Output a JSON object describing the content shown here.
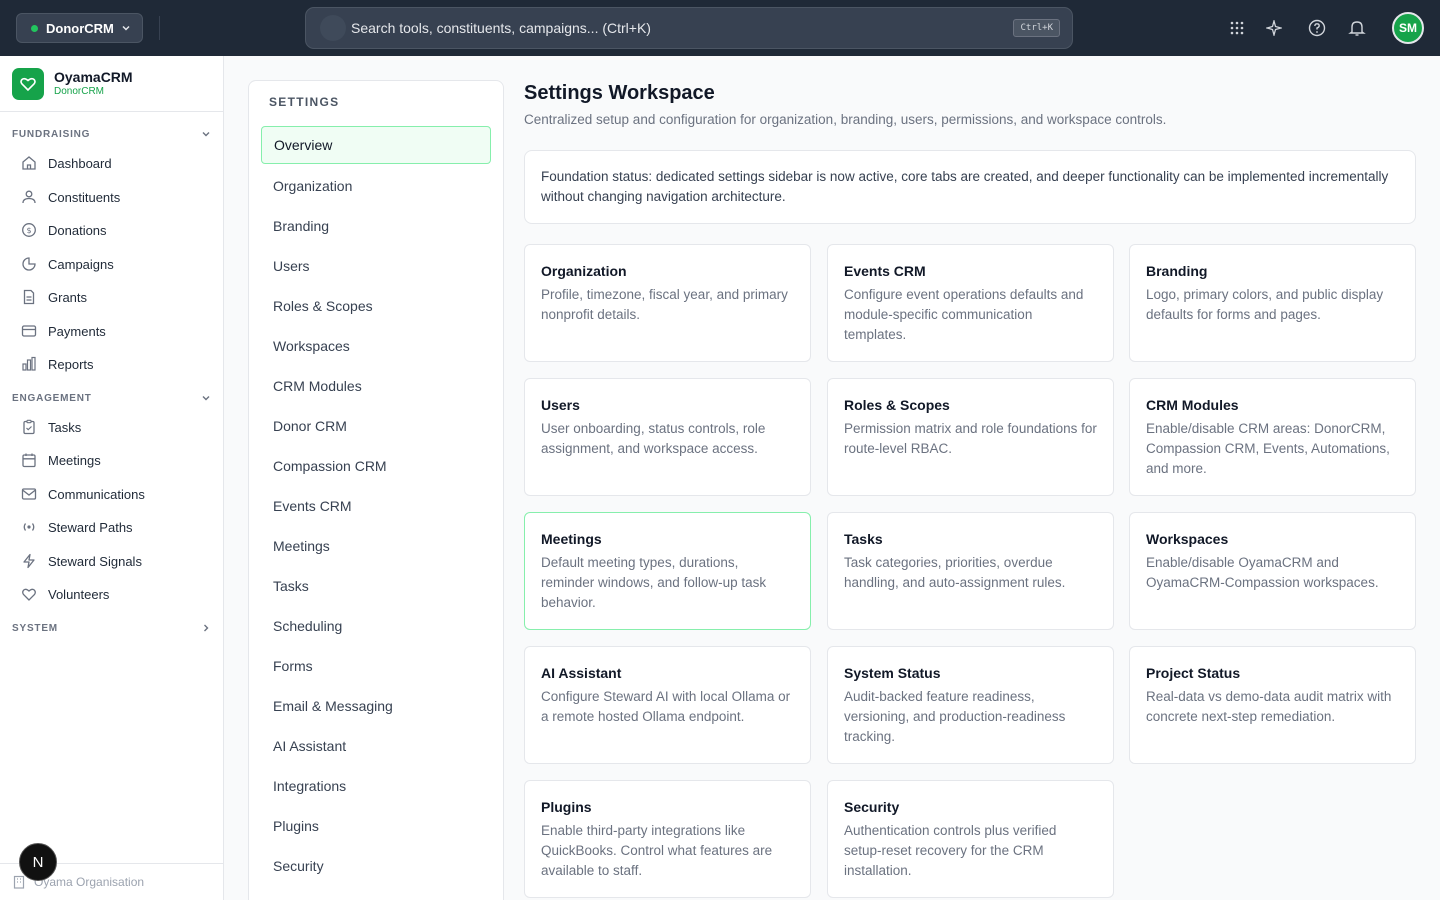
{
  "topbar": {
    "workspace_label": "DonorCRM",
    "search_placeholder": "Search tools, constituents, campaigns... (Ctrl+K)",
    "search_shortcut": "Ctrl+K",
    "avatar_initials": "SM"
  },
  "sidebar": {
    "brand_name": "OyamaCRM",
    "brand_sub": "DonorCRM",
    "sections": [
      {
        "label": "FUNDRAISING"
      },
      {
        "label": "ENGAGEMENT"
      },
      {
        "label": "SYSTEM"
      }
    ],
    "items": [
      {
        "label": "Dashboard",
        "icon": "home-icon"
      },
      {
        "label": "Constituents",
        "icon": "users-icon"
      },
      {
        "label": "Donations",
        "icon": "dollar-icon"
      },
      {
        "label": "Campaigns",
        "icon": "pie-icon"
      },
      {
        "label": "Grants",
        "icon": "document-icon"
      },
      {
        "label": "Payments",
        "icon": "credit-card-icon"
      },
      {
        "label": "Reports",
        "icon": "bar-chart-icon"
      },
      {
        "label": "Tasks",
        "icon": "clipboard-icon"
      },
      {
        "label": "Meetings",
        "icon": "calendar-icon"
      },
      {
        "label": "Communications",
        "icon": "mail-icon"
      },
      {
        "label": "Steward Paths",
        "icon": "radio-icon"
      },
      {
        "label": "Steward Signals",
        "icon": "bolt-icon"
      },
      {
        "label": "Volunteers",
        "icon": "heart-icon"
      }
    ],
    "org_label": "Oyama Organisation",
    "next_badge": "N"
  },
  "settings_nav": {
    "title": "SETTINGS",
    "items": [
      "Overview",
      "Organization",
      "Branding",
      "Users",
      "Roles & Scopes",
      "Workspaces",
      "CRM Modules",
      "Donor CRM",
      "Compassion CRM",
      "Events CRM",
      "Meetings",
      "Tasks",
      "Scheduling",
      "Forms",
      "Email & Messaging",
      "AI Assistant",
      "Integrations",
      "Plugins",
      "Security"
    ],
    "active": "Overview"
  },
  "main": {
    "title": "Settings Workspace",
    "subtitle": "Centralized setup and configuration for organization, branding, users, permissions, and workspace controls.",
    "notice": "Foundation status: dedicated settings sidebar is now active, core tabs are created, and deeper functionality can be implemented incrementally without changing navigation architecture.",
    "cards": [
      {
        "title": "Organization",
        "desc": "Profile, timezone, fiscal year, and primary nonprofit details."
      },
      {
        "title": "Events CRM",
        "desc": "Configure event operations defaults and module-specific communication templates."
      },
      {
        "title": "Branding",
        "desc": "Logo, primary colors, and public display defaults for forms and pages."
      },
      {
        "title": "Users",
        "desc": "User onboarding, status controls, role assignment, and workspace access."
      },
      {
        "title": "Roles & Scopes",
        "desc": "Permission matrix and role foundations for route-level RBAC."
      },
      {
        "title": "CRM Modules",
        "desc": "Enable/disable CRM areas: DonorCRM, Compassion CRM, Events, Automations, and more."
      },
      {
        "title": "Meetings",
        "desc": "Default meeting types, durations, reminder windows, and follow-up task behavior."
      },
      {
        "title": "Tasks",
        "desc": "Task categories, priorities, overdue handling, and auto-assignment rules."
      },
      {
        "title": "Workspaces",
        "desc": "Enable/disable OyamaCRM and OyamaCRM-Compassion workspaces."
      },
      {
        "title": "AI Assistant",
        "desc": "Configure Steward AI with local Ollama or a remote hosted Ollama endpoint."
      },
      {
        "title": "System Status",
        "desc": "Audit-backed feature readiness, versioning, and production-readiness tracking."
      },
      {
        "title": "Project Status",
        "desc": "Real-data vs demo-data audit matrix with concrete next-step remediation."
      },
      {
        "title": "Plugins",
        "desc": "Enable third-party integrations like QuickBooks. Control what features are available to staff."
      },
      {
        "title": "Security",
        "desc": "Authentication controls plus verified setup-reset recovery for the CRM installation."
      }
    ]
  },
  "colors": {
    "accent": "#16a34a",
    "topbar": "#1f2937"
  }
}
